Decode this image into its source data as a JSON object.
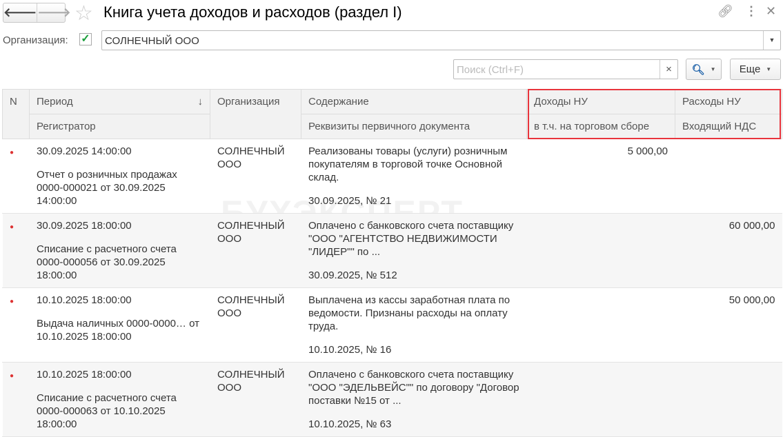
{
  "window": {
    "title": "Книга учета доходов и расходов (раздел I)",
    "back": "🡐",
    "forward": "🡒"
  },
  "filter": {
    "org_label": "Организация:",
    "org_checked": true,
    "org_value": "СОЛНЕЧНЫЙ ООО"
  },
  "toolbar": {
    "search_placeholder": "Поиск (Ctrl+F)",
    "more_label": "Еще"
  },
  "columns": {
    "n": "N",
    "period": "Период",
    "registrator": "Регистратор",
    "org": "Организация",
    "content": "Содержание",
    "doc_details": "Реквизиты первичного документа",
    "income": "Доходы НУ",
    "trade_fee": "в т.ч. на торговом сборе",
    "expense": "Расходы НУ",
    "input_vat": "Входящий НДС"
  },
  "rows": [
    {
      "period": "30.09.2025 14:00:00",
      "registrator": "Отчет о розничных продажах 0000-000021 от 30.09.2025 14:00:00",
      "org": "СОЛНЕЧНЫЙ ООО",
      "content": "Реализованы товары (услуги) розничным покупателям в торговой точке Основной склад.",
      "doc": "30.09.2025, № 21",
      "income": "5 000,00",
      "expense": ""
    },
    {
      "period": "30.09.2025 18:00:00",
      "registrator": "Списание с расчетного счета 0000-000056 от 30.09.2025 18:00:00",
      "org": "СОЛНЕЧНЫЙ ООО",
      "content": "Оплачено с банковского счета поставщику \"ООО \"АГЕНТСТВО НЕДВИЖИМОСТИ \"ЛИДЕР\"\" по ...",
      "doc": "30.09.2025, № 512",
      "income": "",
      "expense": "60 000,00"
    },
    {
      "period": "10.10.2025 18:00:00",
      "registrator": "Выдача наличных 0000-0000… от 10.10.2025 18:00:00",
      "org": "СОЛНЕЧНЫЙ ООО",
      "content": "Выплачена из кассы заработная плата по ведомости. Признаны расходы на оплату труда.",
      "doc": "10.10.2025, № 16",
      "income": "",
      "expense": "50 000,00"
    },
    {
      "period": "10.10.2025 18:00:00",
      "registrator": "Списание с расчетного счета 0000-000063 от 10.10.2025 18:00:00",
      "org": "СОЛНЕЧНЫЙ ООО",
      "content": "Оплачено с банковского счета поставщику \"ООО \"ЭДЕЛЬВЕЙС\"\" по договору \"Договор поставки №15 от ...",
      "doc": "10.10.2025, № 63",
      "income": "",
      "expense": ""
    }
  ],
  "watermark": "БУХЭКСПЕРТ"
}
